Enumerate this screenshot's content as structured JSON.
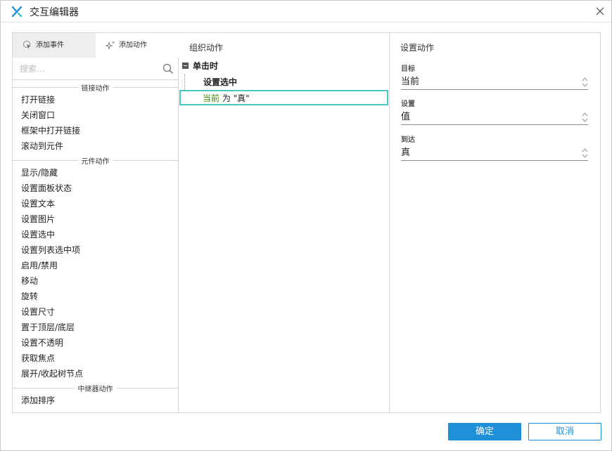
{
  "window": {
    "title": "交互编辑器"
  },
  "left": {
    "tabs": [
      {
        "label": "添加事件",
        "icon": "cursor-click-icon",
        "active": true
      },
      {
        "label": "添加动作",
        "icon": "sparkle-icon",
        "active": false
      }
    ],
    "search": {
      "placeholder": "搜索...",
      "value": ""
    },
    "groups": [
      {
        "header": "链接动作",
        "items": [
          "打开链接",
          "关闭窗口",
          "框架中打开链接",
          "滚动到元件"
        ]
      },
      {
        "header": "元件动作",
        "items": [
          "显示/隐藏",
          "设置面板状态",
          "设置文本",
          "设置图片",
          "设置选中",
          "设置列表选中项",
          "启用/禁用",
          "移动",
          "旋转",
          "设置尺寸",
          "置于顶层/底层",
          "设置不透明",
          "获取焦点",
          "展开/收起树节点"
        ]
      },
      {
        "header": "中继器动作",
        "items": [
          "添加排序"
        ]
      }
    ]
  },
  "middle": {
    "header": "组织动作",
    "event": "单击时",
    "case": "设置选中",
    "action": {
      "target": "当前",
      "connector": " 为 ",
      "value": "\"真\""
    }
  },
  "right": {
    "header": "设置动作",
    "fields": [
      {
        "label": "目标",
        "value": "当前"
      },
      {
        "label": "设置",
        "value": "值"
      },
      {
        "label": "到达",
        "value": "真"
      }
    ]
  },
  "footer": {
    "ok_label": "确定",
    "cancel_label": "取消"
  },
  "colors": {
    "accent": "#1f8fd8",
    "selection": "#45c9c1",
    "target_text": "#3c8d00"
  }
}
